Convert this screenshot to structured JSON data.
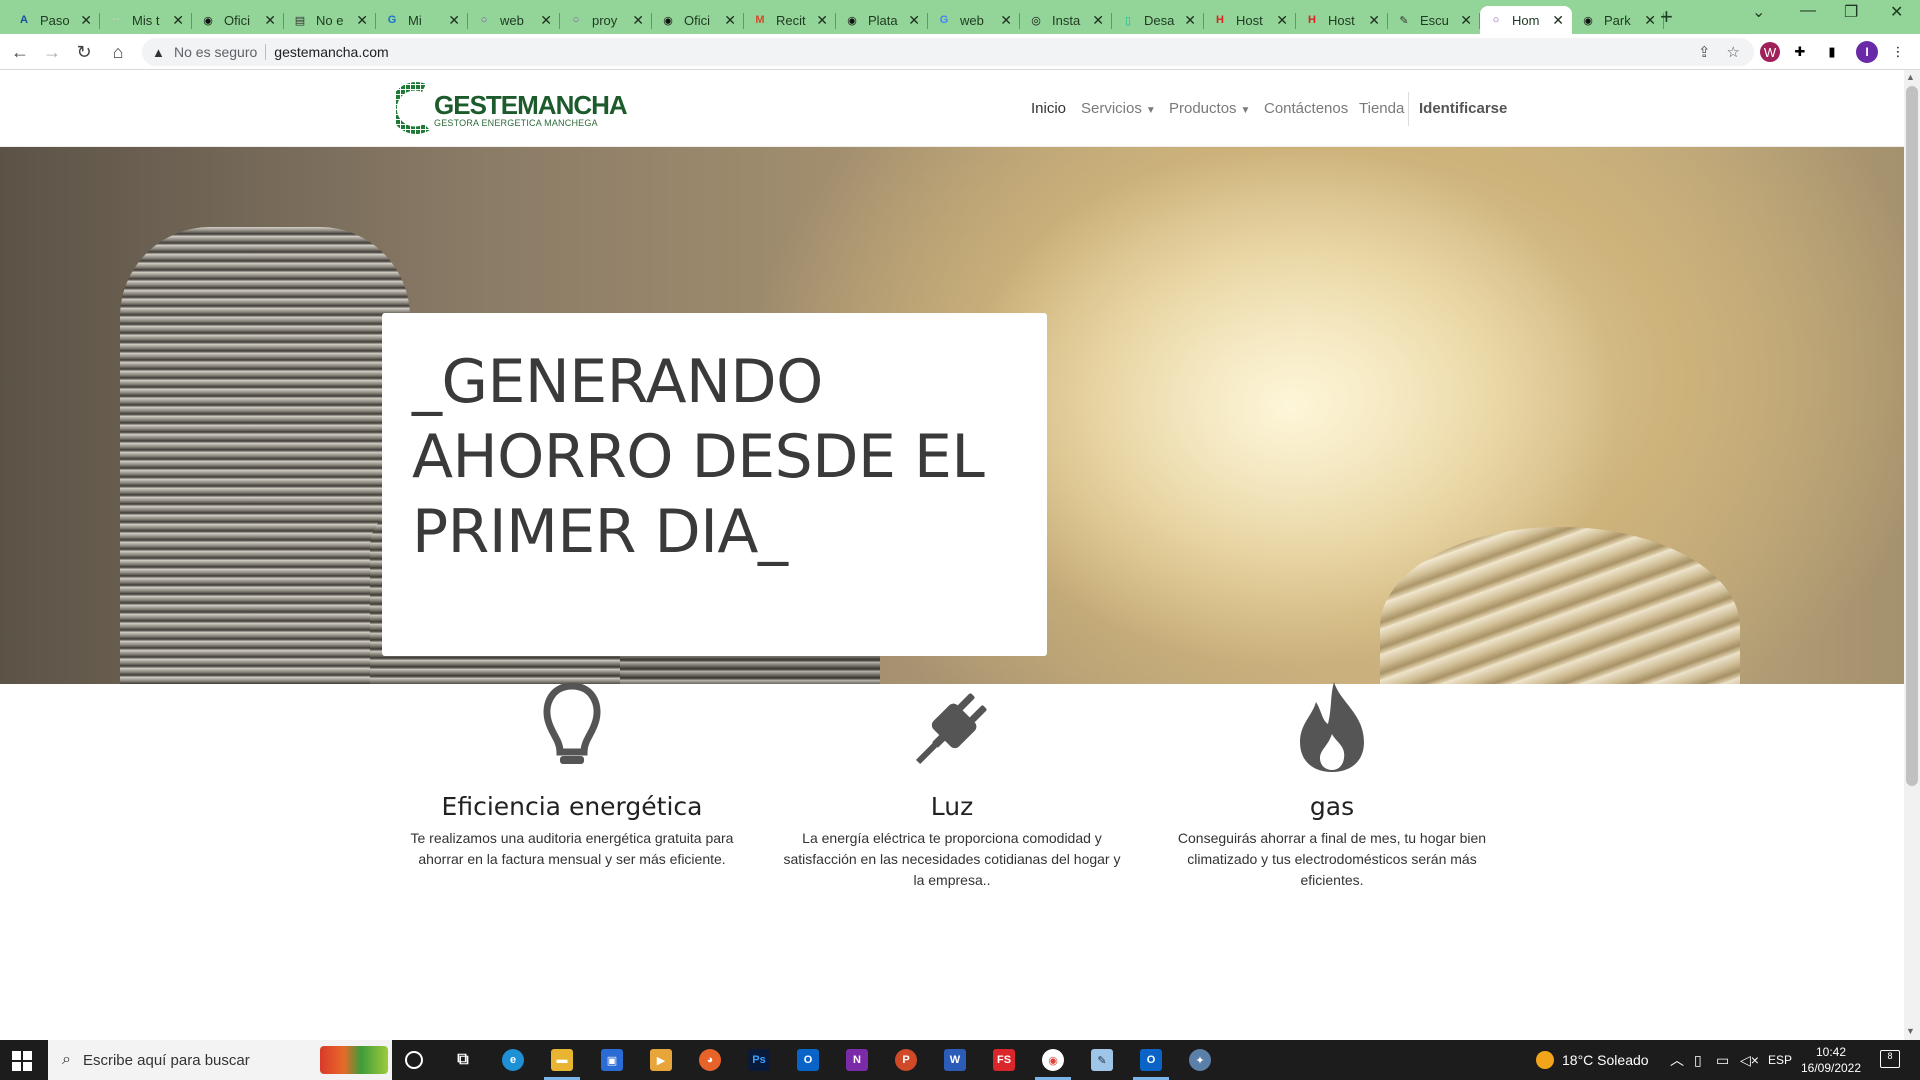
{
  "browser": {
    "tabs": [
      {
        "title": "Paso",
        "favicon_color": "#1a4fa0",
        "favicon_glyph": "A"
      },
      {
        "title": "Mis t",
        "favicon_color": "#cccccc",
        "favicon_glyph": "··"
      },
      {
        "title": "Ofici",
        "favicon_color": "#111111",
        "favicon_glyph": "◉"
      },
      {
        "title": "No e",
        "favicon_color": "#333333",
        "favicon_glyph": "▤"
      },
      {
        "title": "Mi",
        "favicon_color": "#1c6fd1",
        "favicon_glyph": "G"
      },
      {
        "title": "web",
        "favicon_color": "#8a4db0",
        "favicon_glyph": "○"
      },
      {
        "title": "proy",
        "favicon_color": "#8a4db0",
        "favicon_glyph": "○"
      },
      {
        "title": "Ofici",
        "favicon_color": "#111111",
        "favicon_glyph": "◉"
      },
      {
        "title": "Recit",
        "favicon_color": "#d44a2a",
        "favicon_glyph": "M"
      },
      {
        "title": "Plata",
        "favicon_color": "#111111",
        "favicon_glyph": "◉"
      },
      {
        "title": "web",
        "favicon_color": "#4285f4",
        "favicon_glyph": "G"
      },
      {
        "title": "Insta",
        "favicon_color": "#111111",
        "favicon_glyph": "◎"
      },
      {
        "title": "Desa",
        "favicon_color": "#1abc9c",
        "favicon_glyph": "▯"
      },
      {
        "title": "Host",
        "favicon_color": "#e02020",
        "favicon_glyph": "H"
      },
      {
        "title": "Host",
        "favicon_color": "#e02020",
        "favicon_glyph": "H"
      },
      {
        "title": "Escu",
        "favicon_color": "#333333",
        "favicon_glyph": "✎"
      },
      {
        "title": "Hom",
        "favicon_color": "#8a4db0",
        "favicon_glyph": "○",
        "active": true
      },
      {
        "title": "Park",
        "favicon_color": "#111111",
        "favicon_glyph": "◉"
      }
    ],
    "security_label": "No es seguro",
    "url": "gestemancha.com"
  },
  "site": {
    "logo_title": "GESTEMANCHA",
    "logo_subtitle": "GESTORA ENERGETICA MANCHEGA",
    "nav": {
      "inicio": "Inicio",
      "servicios": "Servicios",
      "productos": "Productos",
      "contactenos": "Contáctenos",
      "tienda": "Tienda",
      "identificarse": "Identificarse"
    },
    "hero_text": "_GENERANDO AHORRO DESDE EL PRIMER DIA_",
    "features": [
      {
        "icon": "lightbulb-icon",
        "title": "Eficiencia energética",
        "description": "Te realizamos una auditoria energética gratuita para ahorrar en la factura mensual y ser más eficiente."
      },
      {
        "icon": "plug-icon",
        "title": "Luz",
        "description": "La energía eléctrica te proporciona comodidad y satisfacción en las necesidades cotidianas del hogar y la empresa.."
      },
      {
        "icon": "flame-icon",
        "title": "gas",
        "description": "Conseguirás ahorrar a final de mes, tu hogar bien climatizado y tus electrodomésticos serán más eficientes."
      }
    ]
  },
  "taskbar": {
    "search_placeholder": "Escribe aquí para buscar",
    "weather": "18°C  Soleado",
    "language": "ESP",
    "time": "10:42",
    "date": "16/09/2022",
    "notifications": "8"
  },
  "colors": {
    "tabstrip": "#93d498",
    "brand_green": "#1c5b2b",
    "text_dark": "#333333"
  }
}
